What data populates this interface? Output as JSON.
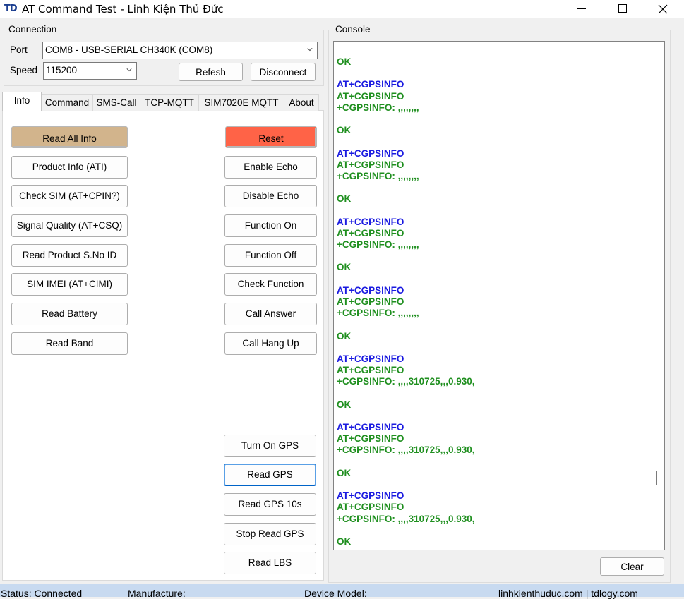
{
  "window": {
    "app_icon": "TD",
    "title": "AT Command Test - Linh Kiện Thủ Đức"
  },
  "connection": {
    "group_label": "Connection",
    "port_label": "Port",
    "port_value": "COM8 - USB-SERIAL CH340K (COM8)",
    "speed_label": "Speed",
    "speed_value": "115200",
    "refresh_label": "Refesh",
    "disconnect_label": "Disconnect"
  },
  "tabs": [
    {
      "label": "Info"
    },
    {
      "label": "Command"
    },
    {
      "label": "SMS-Call"
    },
    {
      "label": "TCP-MQTT"
    },
    {
      "label": "SIM7020E MQTT"
    },
    {
      "label": "About"
    }
  ],
  "info_left_buttons": [
    "Read All Info",
    "Product Info (ATI)",
    "Check SIM (AT+CPIN?)",
    "Signal Quality (AT+CSQ)",
    "Read Product S.No ID",
    "SIM IMEI (AT+CIMI)",
    "Read Battery",
    "Read Band"
  ],
  "info_right_buttons": [
    "Reset",
    "Enable Echo",
    "Disable Echo",
    "Function On",
    "Function Off",
    "Check Function",
    "Call Answer",
    "Call Hang Up"
  ],
  "gps_buttons": [
    "Turn On GPS",
    "Read GPS",
    "Read GPS 10s",
    "Stop Read GPS",
    "Read LBS"
  ],
  "colors": {
    "read_all_bg": "#d2b48c",
    "reset_bg": "#ff6347",
    "cmd_text": "#1a1ae0",
    "resp_text": "#1f8f1f"
  },
  "console": {
    "group_label": "Console",
    "clear_label": "Clear",
    "lines": [
      {
        "t": "OK",
        "k": "resp"
      },
      {
        "t": "",
        "k": "blank"
      },
      {
        "t": "AT+CGPSINFO",
        "k": "cmd"
      },
      {
        "t": "AT+CGPSINFO",
        "k": "resp"
      },
      {
        "t": "+CGPSINFO: ,,,,,,,,",
        "k": "resp"
      },
      {
        "t": "",
        "k": "blank"
      },
      {
        "t": "OK",
        "k": "resp"
      },
      {
        "t": "",
        "k": "blank"
      },
      {
        "t": "AT+CGPSINFO",
        "k": "cmd"
      },
      {
        "t": "AT+CGPSINFO",
        "k": "resp"
      },
      {
        "t": "+CGPSINFO: ,,,,,,,,",
        "k": "resp"
      },
      {
        "t": "",
        "k": "blank"
      },
      {
        "t": "OK",
        "k": "resp"
      },
      {
        "t": "",
        "k": "blank"
      },
      {
        "t": "AT+CGPSINFO",
        "k": "cmd"
      },
      {
        "t": "AT+CGPSINFO",
        "k": "resp"
      },
      {
        "t": "+CGPSINFO: ,,,,,,,,",
        "k": "resp"
      },
      {
        "t": "",
        "k": "blank"
      },
      {
        "t": "OK",
        "k": "resp"
      },
      {
        "t": "",
        "k": "blank"
      },
      {
        "t": "AT+CGPSINFO",
        "k": "cmd"
      },
      {
        "t": "AT+CGPSINFO",
        "k": "resp"
      },
      {
        "t": "+CGPSINFO: ,,,,,,,,",
        "k": "resp"
      },
      {
        "t": "",
        "k": "blank"
      },
      {
        "t": "OK",
        "k": "resp"
      },
      {
        "t": "",
        "k": "blank"
      },
      {
        "t": "AT+CGPSINFO",
        "k": "cmd"
      },
      {
        "t": "AT+CGPSINFO",
        "k": "resp"
      },
      {
        "t": "+CGPSINFO: ,,,,310725,,,0.930,",
        "k": "resp"
      },
      {
        "t": "",
        "k": "blank"
      },
      {
        "t": "OK",
        "k": "resp"
      },
      {
        "t": "",
        "k": "blank"
      },
      {
        "t": "AT+CGPSINFO",
        "k": "cmd"
      },
      {
        "t": "AT+CGPSINFO",
        "k": "resp"
      },
      {
        "t": "+CGPSINFO: ,,,,310725,,,0.930,",
        "k": "resp"
      },
      {
        "t": "",
        "k": "blank"
      },
      {
        "t": "OK",
        "k": "resp"
      },
      {
        "t": "",
        "k": "blank"
      },
      {
        "t": "AT+CGPSINFO",
        "k": "cmd"
      },
      {
        "t": "AT+CGPSINFO",
        "k": "resp"
      },
      {
        "t": "+CGPSINFO: ,,,,310725,,,0.930,",
        "k": "resp"
      },
      {
        "t": "",
        "k": "blank"
      },
      {
        "t": "OK",
        "k": "resp"
      }
    ]
  },
  "status": {
    "status": "Status: Connected",
    "manufacture": "Manufacture:",
    "device_model": "Device Model:",
    "site": "linhkienthuduc.com | tdlogy.com"
  }
}
